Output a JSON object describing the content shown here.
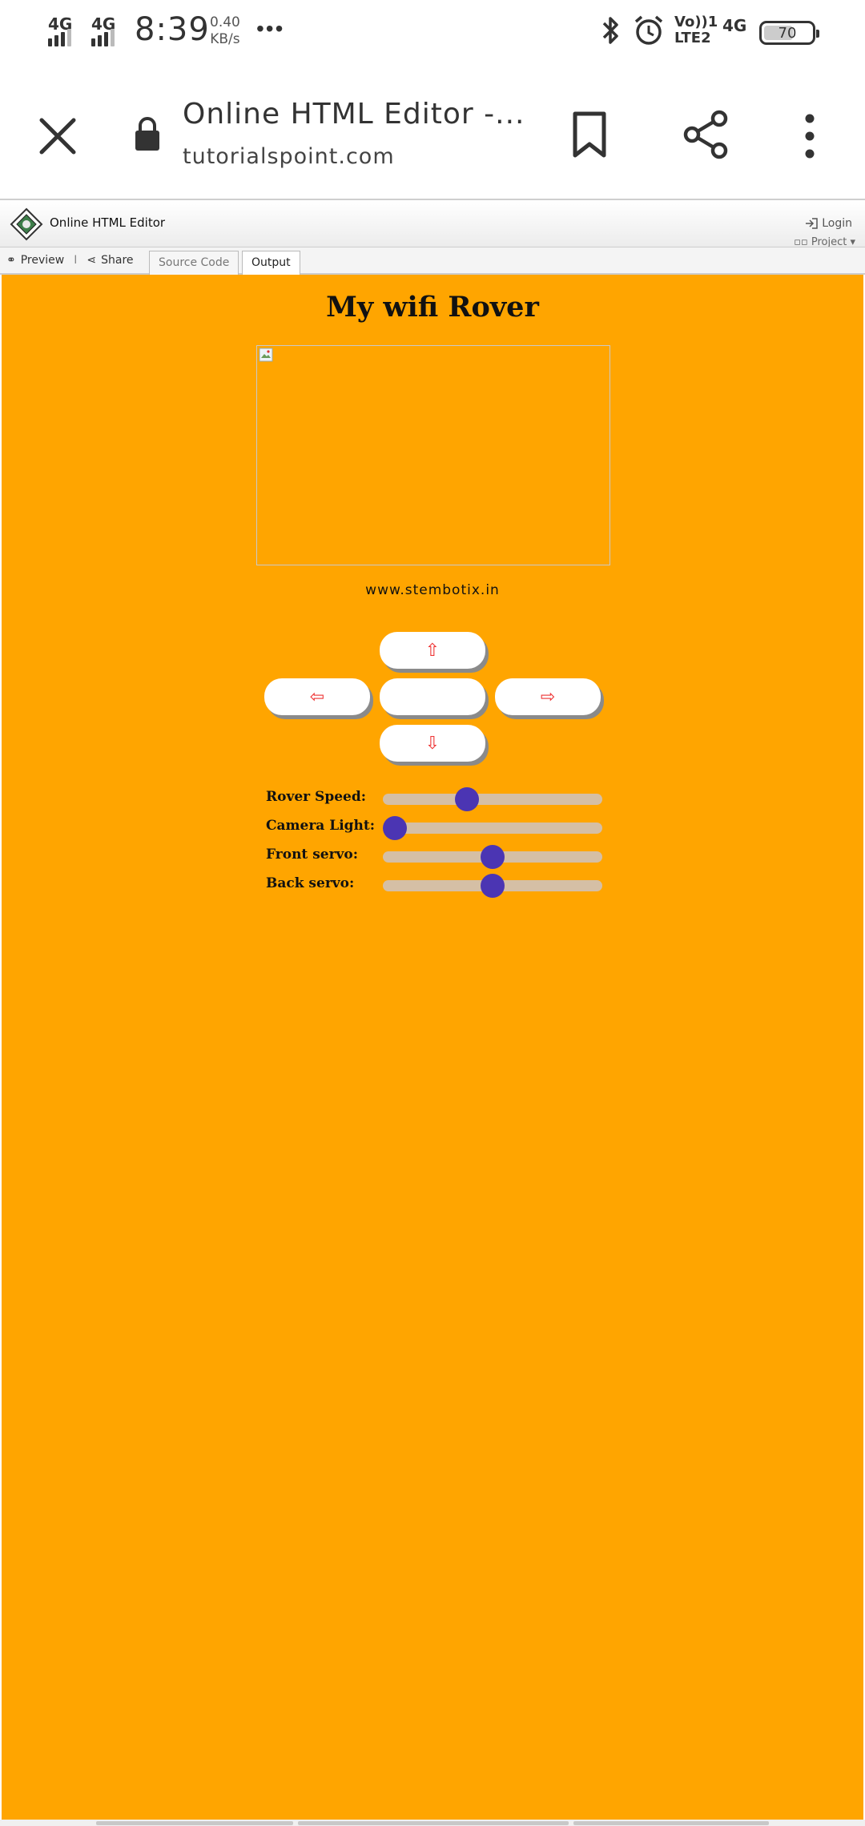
{
  "status_bar": {
    "net1": "4G",
    "net2": "4G",
    "time": "8:39",
    "speed_value": "0.40",
    "speed_unit": "KB/s",
    "more": "•••",
    "volte_top": "Vo))1",
    "volte_bottom": "LTE2",
    "net3": "4G",
    "battery_level": "70",
    "icons": [
      "bluetooth-icon",
      "alarm-icon"
    ]
  },
  "browser": {
    "page_title": "Online HTML Editor -...",
    "url": "tutorialspoint.com",
    "icons": [
      "close-icon",
      "lock-icon",
      "bookmark-icon",
      "share-icon",
      "more-vert-icon"
    ]
  },
  "editor": {
    "title": "Online HTML Editor",
    "login_label": "Login",
    "project_label": "Project",
    "preview_label": "Preview",
    "share_label": "Share",
    "tabs": [
      {
        "label": "Source Code",
        "active": false
      },
      {
        "label": "Output",
        "active": true
      }
    ]
  },
  "output": {
    "background": "#ffa500",
    "heading": "My wifi Rover",
    "site_link": "www.stembotix.in",
    "controls": {
      "up": "⇧",
      "left": "⇦",
      "center": "",
      "right": "⇨",
      "down": "⇩"
    },
    "sliders": [
      {
        "label": "Rover Speed:",
        "value_fraction": 0.37
      },
      {
        "label": "Camera Light:",
        "value_fraction": 0.0
      },
      {
        "label": "Front servo:",
        "value_fraction": 0.5
      },
      {
        "label": "Back servo:",
        "value_fraction": 0.5
      }
    ],
    "slider_accent": "#4b35b3"
  }
}
